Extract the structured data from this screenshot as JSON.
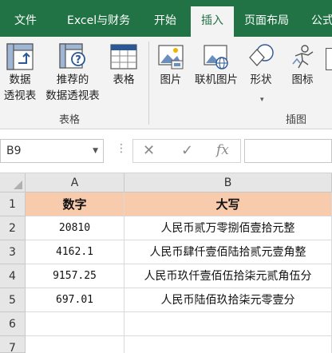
{
  "ribbon_tabs": [
    {
      "label": "文件",
      "active": false
    },
    {
      "label": "Excel与财务",
      "active": false
    },
    {
      "label": "开始",
      "active": false
    },
    {
      "label": "插入",
      "active": true
    },
    {
      "label": "页面布局",
      "active": false
    },
    {
      "label": "公式",
      "active": false
    }
  ],
  "ribbon": {
    "pivot_table": {
      "line1": "数据",
      "line2": "透视表"
    },
    "recommended_pivot": {
      "line1": "推荐的",
      "line2": "数据透视表"
    },
    "table": "表格",
    "tables_group": "表格",
    "pictures": "图片",
    "online_pictures": "联机图片",
    "shapes": "形状",
    "icons": "图标",
    "illustrations_group": "插图"
  },
  "formula_bar": {
    "name_box": "B9",
    "cancel_symbol": "✕",
    "enter_symbol": "✓",
    "function_symbol": "fx",
    "formula": ""
  },
  "sheet": {
    "columns": [
      "A",
      "B"
    ],
    "rows": [
      "1",
      "2",
      "3",
      "4",
      "5",
      "6",
      "7"
    ],
    "header": {
      "a": "数字",
      "b": "大写"
    },
    "data": [
      {
        "a": "20810",
        "b": "人民币贰万零捌佰壹拾元整"
      },
      {
        "a": "4162.1",
        "b": "人民币肆仟壹佰陆拾贰元壹角整"
      },
      {
        "a": "9157.25",
        "b": "人民币玖仟壹佰伍拾柒元贰角伍分"
      },
      {
        "a": "697.01",
        "b": "人民币陆佰玖拾柒元零壹分"
      },
      {
        "a": "",
        "b": ""
      },
      {
        "a": "",
        "b": ""
      }
    ]
  },
  "colors": {
    "accent": "#217346",
    "header_fill": "#f8cbad"
  }
}
